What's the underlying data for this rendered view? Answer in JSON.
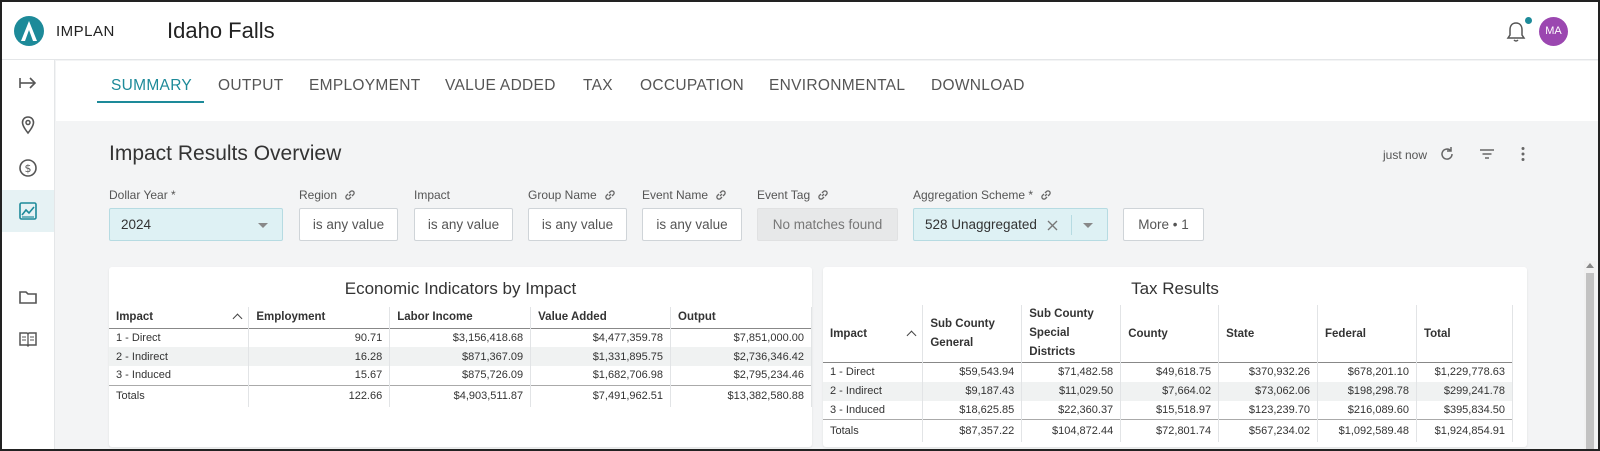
{
  "header": {
    "brand": "IMPLAN",
    "title": "Idaho Falls",
    "avatar_initials": "MA"
  },
  "tabs": [
    "SUMMARY",
    "OUTPUT",
    "EMPLOYMENT",
    "VALUE ADDED",
    "TAX",
    "OCCUPATION",
    "ENVIRONMENTAL",
    "DOWNLOAD"
  ],
  "main": {
    "title": "Impact Results Overview",
    "status": "just now"
  },
  "filters": {
    "dollar_year": {
      "label": "Dollar Year *",
      "value": "2024"
    },
    "region": {
      "label": "Region",
      "value": "is any value"
    },
    "impact": {
      "label": "Impact",
      "value": "is any value"
    },
    "group_name": {
      "label": "Group Name",
      "value": "is any value"
    },
    "event_name": {
      "label": "Event Name",
      "value": "is any value"
    },
    "event_tag": {
      "label": "Event Tag",
      "value": "No matches found"
    },
    "aggregation": {
      "label": "Aggregation Scheme *",
      "value": "528 Unaggregated"
    },
    "more": "More • 1"
  },
  "economic": {
    "title": "Economic Indicators by Impact",
    "columns": [
      "Impact",
      "Employment",
      "Labor Income",
      "Value Added",
      "Output"
    ],
    "rows": [
      [
        "1 - Direct",
        "90.71",
        "$3,156,418.68",
        "$4,477,359.78",
        "$7,851,000.00"
      ],
      [
        "2 - Indirect",
        "16.28",
        "$871,367.09",
        "$1,331,895.75",
        "$2,736,346.42"
      ],
      [
        "3 - Induced",
        "15.67",
        "$875,726.09",
        "$1,682,706.98",
        "$2,795,234.46"
      ],
      [
        "Totals",
        "122.66",
        "$4,903,511.87",
        "$7,491,962.51",
        "$13,382,580.88"
      ]
    ]
  },
  "tax": {
    "title": "Tax Results",
    "columns": [
      "Impact",
      "Sub County General",
      "Sub County Special Districts",
      "County",
      "State",
      "Federal",
      "Total"
    ],
    "rows": [
      [
        "1 - Direct",
        "$59,543.94",
        "$71,482.58",
        "$49,618.75",
        "$370,932.26",
        "$678,201.10",
        "$1,229,778.63"
      ],
      [
        "2 - Indirect",
        "$9,187.43",
        "$11,029.50",
        "$7,664.02",
        "$73,062.06",
        "$198,298.78",
        "$299,241.78"
      ],
      [
        "3 - Induced",
        "$18,625.85",
        "$22,360.37",
        "$15,518.97",
        "$123,239.70",
        "$216,089.60",
        "$395,834.50"
      ],
      [
        "Totals",
        "$87,357.22",
        "$104,872.44",
        "$72,801.74",
        "$567,234.02",
        "$1,092,589.48",
        "$1,924,854.91"
      ]
    ]
  },
  "colors": {
    "accent": "#1d8a99",
    "avatar": "#9b47b0"
  }
}
